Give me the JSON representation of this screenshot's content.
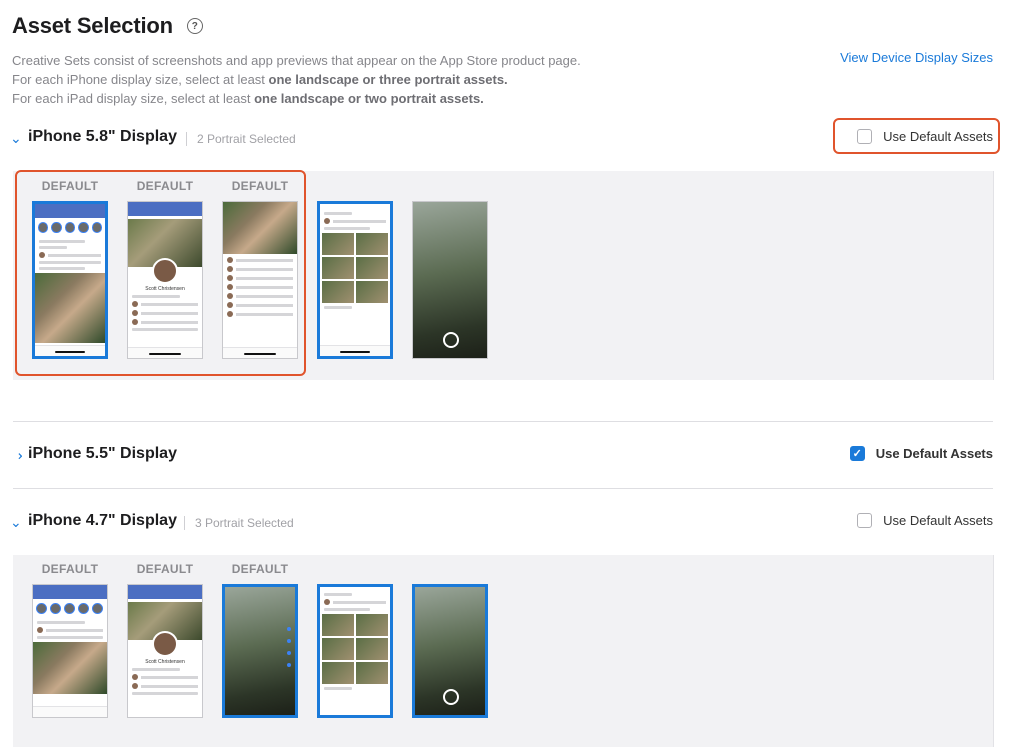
{
  "header": {
    "title": "Asset Selection",
    "help_icon": "question-circle-icon",
    "desc_line1": "Creative Sets consist of screenshots and app previews that appear on the App Store product page.",
    "desc_line2_prefix": "For each iPhone display size, select at least ",
    "desc_line2_bold": "one landscape or three portrait assets.",
    "desc_line3_prefix": "For each iPad display size, select at least ",
    "desc_line3_bold": "one landscape or two portrait assets.",
    "view_link": "View Device Display Sizes"
  },
  "sections": [
    {
      "title": "iPhone 5.8\" Display",
      "subtitle": "2 Portrait Selected",
      "expanded": true,
      "use_default_label": "Use Default Assets",
      "use_default_checked": false,
      "assets": [
        {
          "label": "DEFAULT",
          "selected": true
        },
        {
          "label": "DEFAULT",
          "selected": false
        },
        {
          "label": "DEFAULT",
          "selected": false
        },
        {
          "label": "",
          "selected": true
        },
        {
          "label": "",
          "selected": false
        }
      ]
    },
    {
      "title": "iPhone 5.5\" Display",
      "subtitle": "",
      "expanded": false,
      "use_default_label": "Use Default Assets",
      "use_default_checked": true
    },
    {
      "title": "iPhone 4.7\" Display",
      "subtitle": "3 Portrait Selected",
      "expanded": true,
      "use_default_label": "Use Default Assets",
      "use_default_checked": false,
      "assets": [
        {
          "label": "DEFAULT",
          "selected": false
        },
        {
          "label": "DEFAULT",
          "selected": false
        },
        {
          "label": "DEFAULT",
          "selected": true
        },
        {
          "label": "",
          "selected": true
        },
        {
          "label": "",
          "selected": true
        }
      ]
    }
  ],
  "colors": {
    "accent": "#1a7ad9",
    "highlight": "#e0542c",
    "tray": "#f2f2f4"
  }
}
